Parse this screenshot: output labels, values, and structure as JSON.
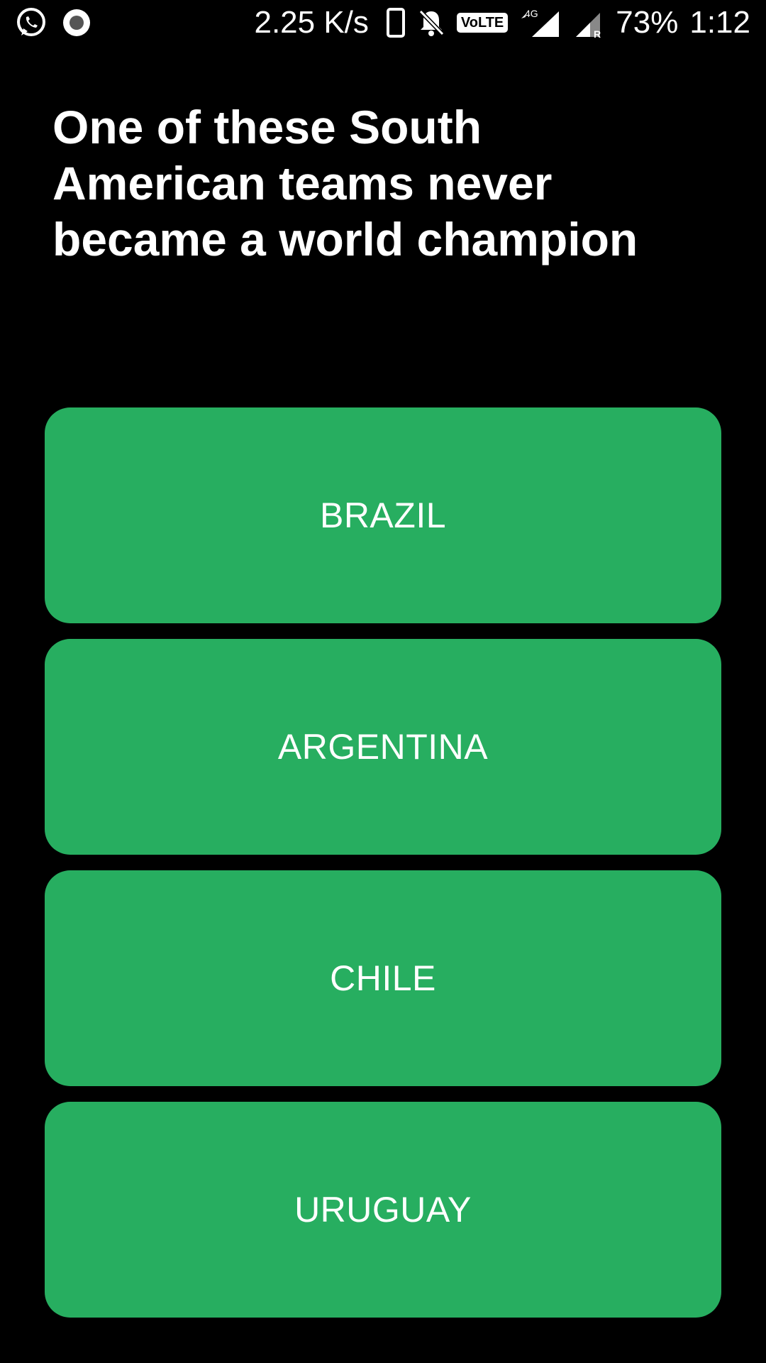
{
  "status_bar": {
    "left_icons": [
      "whatsapp-icon",
      "record-icon"
    ],
    "net_speed": "2.25 K/s",
    "volte_label": "VoLTE",
    "network_label": "4G",
    "roaming_label": "R",
    "battery": "73%",
    "time": "1:12"
  },
  "question": {
    "text": "One of these South American teams never became a world champion"
  },
  "answers": [
    {
      "label": "BRAZIL"
    },
    {
      "label": "ARGENTINA"
    },
    {
      "label": "CHILE"
    },
    {
      "label": "URUGUAY"
    }
  ],
  "colors": {
    "background": "#000000",
    "answer_button": "#27ae60",
    "text": "#ffffff"
  }
}
